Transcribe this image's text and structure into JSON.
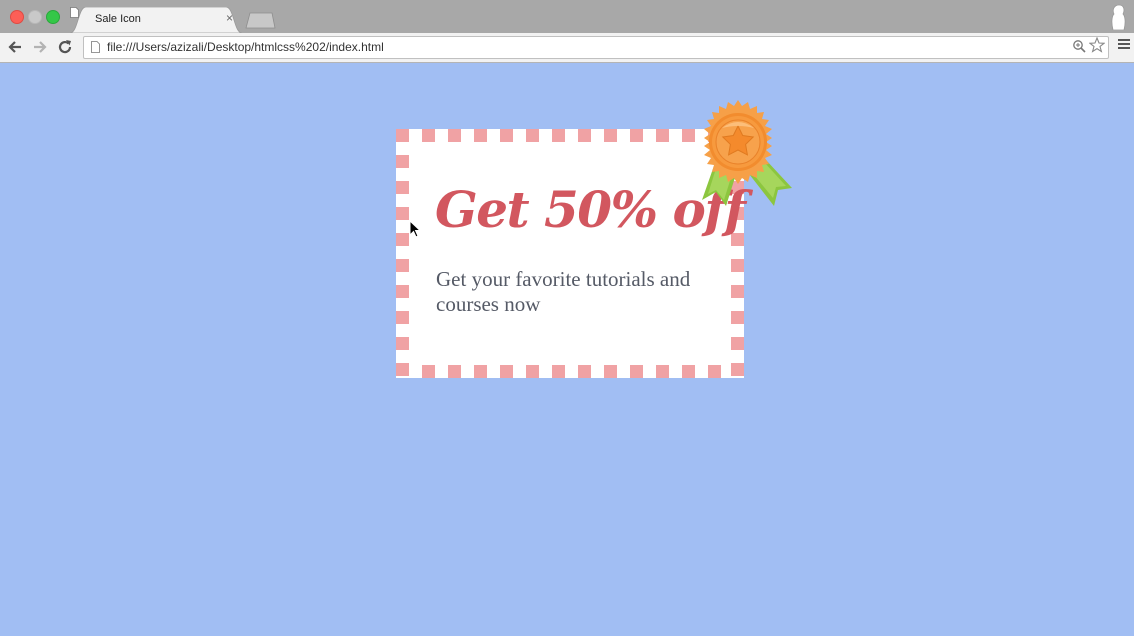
{
  "browser": {
    "tab_title": "Sale Icon",
    "tab_close": "×",
    "url": "file:///Users/azizali/Desktop/htmlcss%202/index.html"
  },
  "toolbar": {
    "back_icon": "arrow-left-icon",
    "forward_icon": "arrow-right-icon",
    "reload_icon": "reload-icon",
    "zoom_icon": "zoom-icon",
    "star_icon": "star-icon",
    "menu_icon": "hamburger-menu-icon"
  },
  "coupon": {
    "headline": "Get 50% off",
    "description": "Get your favorite tutorials and courses now",
    "badge_icon": "award-ribbon-icon"
  },
  "colors": {
    "page_background": "#a1bef3",
    "stripe": "#f0a2a4",
    "headline": "#d2575f",
    "description": "#555a66",
    "badge_orange": "#f4913a",
    "badge_ribbon": "#8cc63f"
  }
}
